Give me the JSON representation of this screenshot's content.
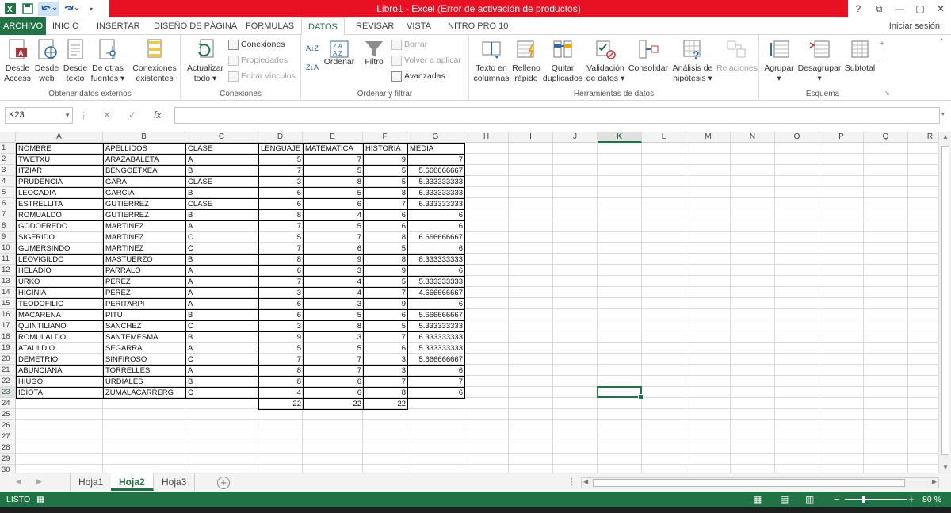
{
  "window": {
    "title": "Libro1 -  Excel (Error de activación de productos)",
    "controls": [
      "?",
      "⧉",
      "—",
      "▢",
      "✕"
    ]
  },
  "ribbon_tabs": [
    "ARCHIVO",
    "INICIO",
    "INSERTAR",
    "DISEÑO DE PÁGINA",
    "FÓRMULAS",
    "DATOS",
    "REVISAR",
    "VISTA",
    "NITRO PRO 10"
  ],
  "active_tab": "DATOS",
  "sign_in": "Iniciar sesión",
  "groups": {
    "external": {
      "label": "Obtener datos externos",
      "b1": [
        "Desde",
        "Access"
      ],
      "b2": [
        "Desde",
        "web"
      ],
      "b3": [
        "Desde",
        "texto"
      ],
      "b4": [
        "De otras",
        "fuentes ▾"
      ],
      "b5": [
        "Conexiones",
        "existentes"
      ]
    },
    "connections": {
      "label": "Conexiones",
      "refresh": [
        "Actualizar",
        "todo ▾"
      ],
      "s1": "Conexiones",
      "s2": "Propiedades",
      "s3": "Editar vínculos"
    },
    "sort": {
      "label": "Ordenar y filtrar",
      "az": "A↓Z",
      "za": "Z↓A",
      "sort": "Ordenar",
      "filter": "Filtro",
      "s1": "Borrar",
      "s2": "Volver a aplicar",
      "s3": "Avanzadas"
    },
    "tools": {
      "label": "Herramientas de datos",
      "b1": [
        "Texto en",
        "columnas"
      ],
      "b2": [
        "Relleno",
        "rápido"
      ],
      "b3": [
        "Quitar",
        "duplicados"
      ],
      "b4": [
        "Validación",
        "de datos ▾"
      ],
      "b5": [
        "Consolidar",
        ""
      ],
      "b6": [
        "Análisis de",
        "hipótesis ▾"
      ],
      "b7": [
        "Relaciones",
        ""
      ]
    },
    "outline": {
      "label": "Esquema",
      "b1": [
        "Agrupar",
        "▾"
      ],
      "b2": [
        "Desagrupar",
        "▾"
      ],
      "b3": [
        "Subtotal",
        ""
      ]
    }
  },
  "formula_bar": {
    "name_box": "K23",
    "fx": "fx",
    "cancel": "✕",
    "enter": "✓",
    "formula": ""
  },
  "columns": [
    "A",
    "B",
    "C",
    "D",
    "E",
    "F",
    "G",
    "H",
    "I",
    "J",
    "K",
    "L",
    "M",
    "N",
    "O",
    "P",
    "Q",
    "R"
  ],
  "row_numbers": [
    "1",
    "2",
    "3",
    "4",
    "5",
    "6",
    "7",
    "8",
    "9",
    "10",
    "11",
    "12",
    "13",
    "14",
    "15",
    "16",
    "17",
    "18",
    "19",
    "20",
    "21",
    "22",
    "23",
    "24",
    "25",
    "26",
    "27",
    "28",
    "29",
    "30"
  ],
  "selected_cell": "K23",
  "table": {
    "headers": [
      "NOMBRE",
      "APELLIDOS",
      "CLASE",
      "LENGUAJE",
      "MATEMATICA",
      "HISTORIA",
      "MEDIA"
    ],
    "rows": [
      [
        "TWETXU",
        "ARAZABALETA",
        "A",
        "5",
        "7",
        "9",
        "7"
      ],
      [
        "ITZIAR",
        "BENGOETXEA",
        "B",
        "7",
        "5",
        "5",
        "5.666666667"
      ],
      [
        "PRUDENCIA",
        "GARA",
        "CLASE",
        "3",
        "8",
        "5",
        "5.333333333"
      ],
      [
        "LEOCADIA",
        "GARCIA",
        "B",
        "6",
        "5",
        "8",
        "6.333333333"
      ],
      [
        "ESTRELLITA",
        "GUTIERREZ",
        "CLASE",
        "6",
        "6",
        "7",
        "6.333333333"
      ],
      [
        "ROMUALDO",
        "GUTIERREZ",
        "B",
        "8",
        "4",
        "6",
        "6"
      ],
      [
        "GODOFREDO",
        "MARTINEZ",
        "A",
        "7",
        "5",
        "6",
        "6"
      ],
      [
        "SIGFRIDO",
        "MARTINEZ",
        "C",
        "5",
        "7",
        "8",
        "6.666666667"
      ],
      [
        "GUMERSINDO",
        "MARTINEZ",
        "C",
        "7",
        "6",
        "5",
        "6"
      ],
      [
        "LEOVIGILDO",
        "MASTUERZO",
        "B",
        "8",
        "9",
        "8",
        "8.333333333"
      ],
      [
        "HELADIO",
        "PARRALO",
        "A",
        "6",
        "3",
        "9",
        "6"
      ],
      [
        "URKO",
        "PEREZ",
        "A",
        "7",
        "4",
        "5",
        "5.333333333"
      ],
      [
        "HIGINIA",
        "PEREZ",
        "A",
        "3",
        "4",
        "7",
        "4.666666667"
      ],
      [
        "TEODOFILIO",
        "PERITARPI",
        "A",
        "6",
        "3",
        "9",
        "6"
      ],
      [
        "MACARENA",
        "PITU",
        "B",
        "6",
        "5",
        "6",
        "5.666666667"
      ],
      [
        "QUINTILIANO",
        "SANCHEZ",
        "C",
        "3",
        "8",
        "5",
        "5.333333333"
      ],
      [
        "ROMULALDO",
        "SANTEMESMA",
        "B",
        "9",
        "3",
        "7",
        "6.333333333"
      ],
      [
        "ATAULDIO",
        "SEGARRA",
        "A",
        "5",
        "5",
        "6",
        "5.333333333"
      ],
      [
        "DEMETRIO",
        "SINFIROSO",
        "C",
        "7",
        "7",
        "3",
        "5.666666667"
      ],
      [
        "ABUNCIANA",
        "TORRELLES",
        "A",
        "8",
        "7",
        "3",
        "6"
      ],
      [
        "HIUGO",
        "URDIALES",
        "B",
        "8",
        "6",
        "7",
        "7"
      ],
      [
        "IDIOTA",
        "ZUMALACARRERG",
        "C",
        "4",
        "6",
        "8",
        "6"
      ]
    ],
    "totals": [
      "22",
      "22",
      "22"
    ]
  },
  "sheets": [
    "Hoja1",
    "Hoja2",
    "Hoja3"
  ],
  "active_sheet": "Hoja2",
  "status": {
    "ready": "LISTO",
    "zoom": "80 %",
    "zoom_minus": "−",
    "zoom_plus": "+"
  },
  "colors": {
    "excel_green": "#217346",
    "error_red": "#e81123"
  }
}
